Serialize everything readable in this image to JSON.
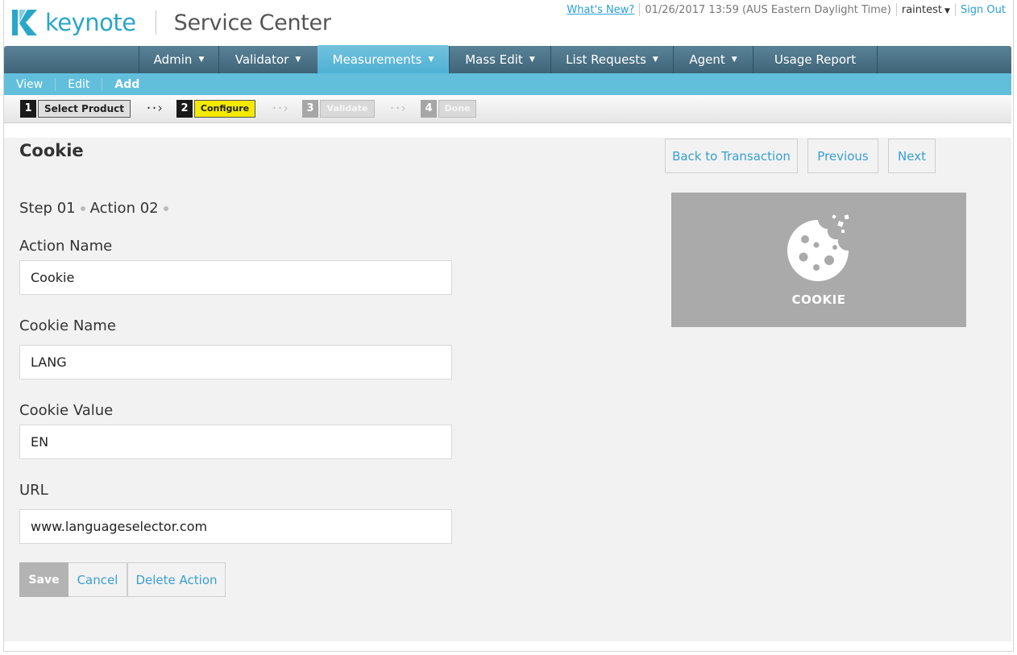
{
  "header": {
    "logo_text": "keynote",
    "app_name": "Service Center",
    "whats_new": "What's New?",
    "datetime": "01/26/2017 13:59 (AUS Eastern Daylight Time)",
    "user": "raintest",
    "sign_out": "Sign Out"
  },
  "nav": {
    "items": [
      {
        "label": "Admin"
      },
      {
        "label": "Validator"
      },
      {
        "label": "Measurements"
      },
      {
        "label": "Mass Edit"
      },
      {
        "label": "List Requests"
      },
      {
        "label": "Agent"
      },
      {
        "label": "Usage Report"
      }
    ],
    "active": "Measurements"
  },
  "subnav": {
    "items": [
      "View",
      "Edit",
      "Add"
    ]
  },
  "wizard": {
    "steps": [
      {
        "num": "1",
        "label": "Select Product"
      },
      {
        "num": "2",
        "label": "Configure"
      },
      {
        "num": "3",
        "label": "Validate"
      },
      {
        "num": "4",
        "label": "Done"
      }
    ],
    "current_step": 2
  },
  "page": {
    "title": "Cookie",
    "back_button": "Back to Transaction",
    "previous_button": "Previous",
    "next_button": "Next",
    "breadcrumb": {
      "step": "Step 01",
      "action": "Action 02"
    }
  },
  "form": {
    "action_name": {
      "label": "Action Name",
      "value": "Cookie"
    },
    "cookie_name": {
      "label": "Cookie Name",
      "value": "LANG"
    },
    "cookie_value": {
      "label": "Cookie Value",
      "value": "EN"
    },
    "url": {
      "label": "URL",
      "value": "www.languageselector.com"
    }
  },
  "preview": {
    "label": "COOKIE",
    "icon": "cookie-icon"
  },
  "actions": {
    "save": "Save",
    "cancel": "Cancel",
    "delete": "Delete Action"
  },
  "colors": {
    "brand": "#2aa6c9",
    "nav_bg": "#4b7185",
    "nav_active": "#5fb9d9",
    "subnav_bg": "#62bfdc",
    "step_current": "#f4ea00",
    "link": "#3a9fd0"
  }
}
